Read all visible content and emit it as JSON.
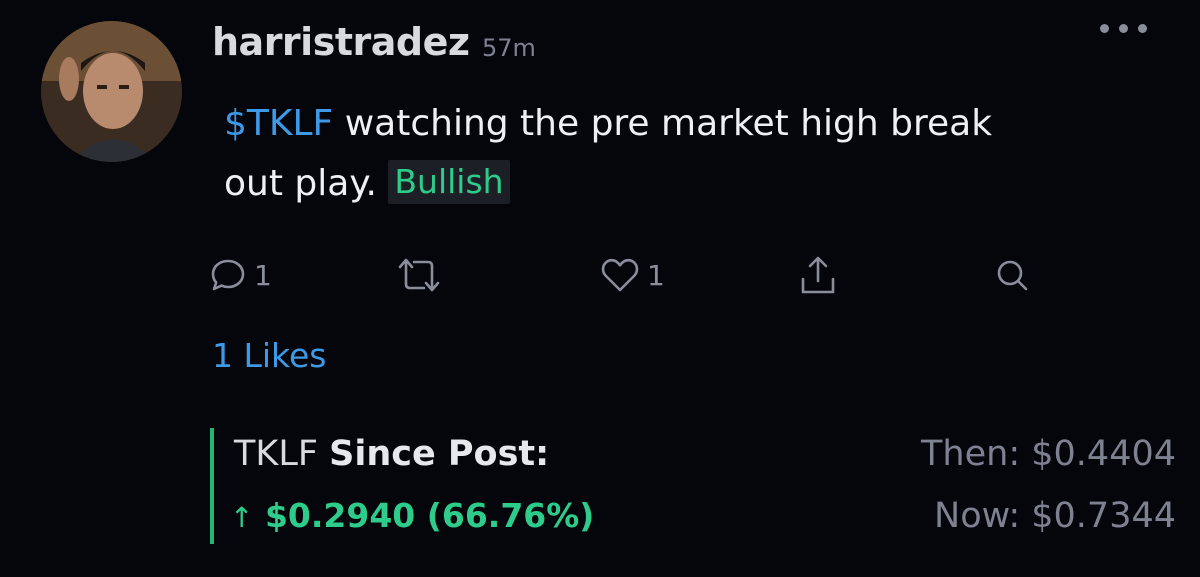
{
  "post": {
    "username": "harristradez",
    "timestamp": "57m",
    "cashtag": "$TKLF",
    "body_line1": " watching the pre market high break",
    "body_line2": "out play.",
    "sentiment": "Bullish"
  },
  "actions": {
    "reply_count": "1",
    "like_count": "1"
  },
  "likes_text": "1 Likes",
  "performance": {
    "symbol": "TKLF",
    "since_post_label": "Since Post:",
    "arrow": "↑",
    "change_amount": "$0.2940",
    "change_percent": "(66.76%)",
    "then_label": "Then:",
    "then_value": "$0.4404",
    "now_label": "Now:",
    "now_value": "$0.7344"
  },
  "colors": {
    "background": "#05060c",
    "link_blue": "#3d9ae8",
    "bullish_green": "#2ecc8a",
    "muted_gray": "#7d8190"
  },
  "icons": [
    "more-icon",
    "reply-icon",
    "reshare-icon",
    "like-icon",
    "share-icon",
    "search-icon"
  ]
}
